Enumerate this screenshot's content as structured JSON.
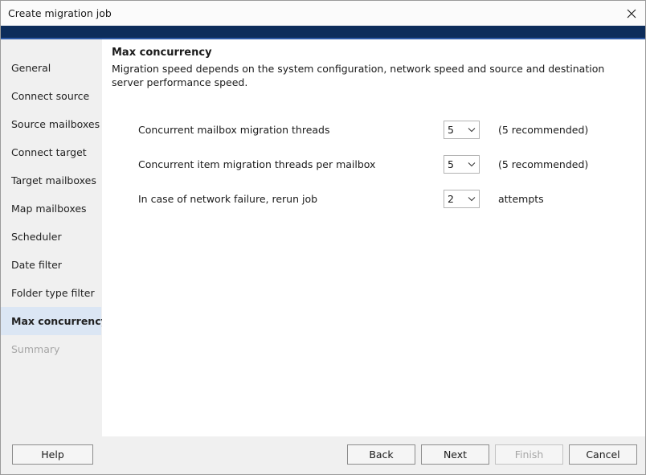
{
  "window": {
    "title": "Create migration job"
  },
  "sidebar": {
    "items": [
      {
        "label": "General"
      },
      {
        "label": "Connect source"
      },
      {
        "label": "Source mailboxes"
      },
      {
        "label": "Connect target"
      },
      {
        "label": "Target mailboxes"
      },
      {
        "label": "Map mailboxes"
      },
      {
        "label": "Scheduler"
      },
      {
        "label": "Date filter"
      },
      {
        "label": "Folder type filter"
      },
      {
        "label": "Max concurrency"
      },
      {
        "label": "Summary"
      }
    ],
    "active_index": 9,
    "disabled_index": 10
  },
  "main": {
    "heading": "Max concurrency",
    "description": "Migration speed depends on the system configuration, network speed and source and destination server performance speed.",
    "rows": [
      {
        "label": "Concurrent mailbox migration threads",
        "value": "5",
        "hint": "(5 recommended)"
      },
      {
        "label": "Concurrent item migration threads per mailbox",
        "value": "5",
        "hint": "(5 recommended)"
      },
      {
        "label": "In case of network failure, rerun job",
        "value": "2",
        "hint": "attempts"
      }
    ]
  },
  "footer": {
    "help": "Help",
    "back": "Back",
    "next": "Next",
    "finish": "Finish",
    "cancel": "Cancel"
  }
}
